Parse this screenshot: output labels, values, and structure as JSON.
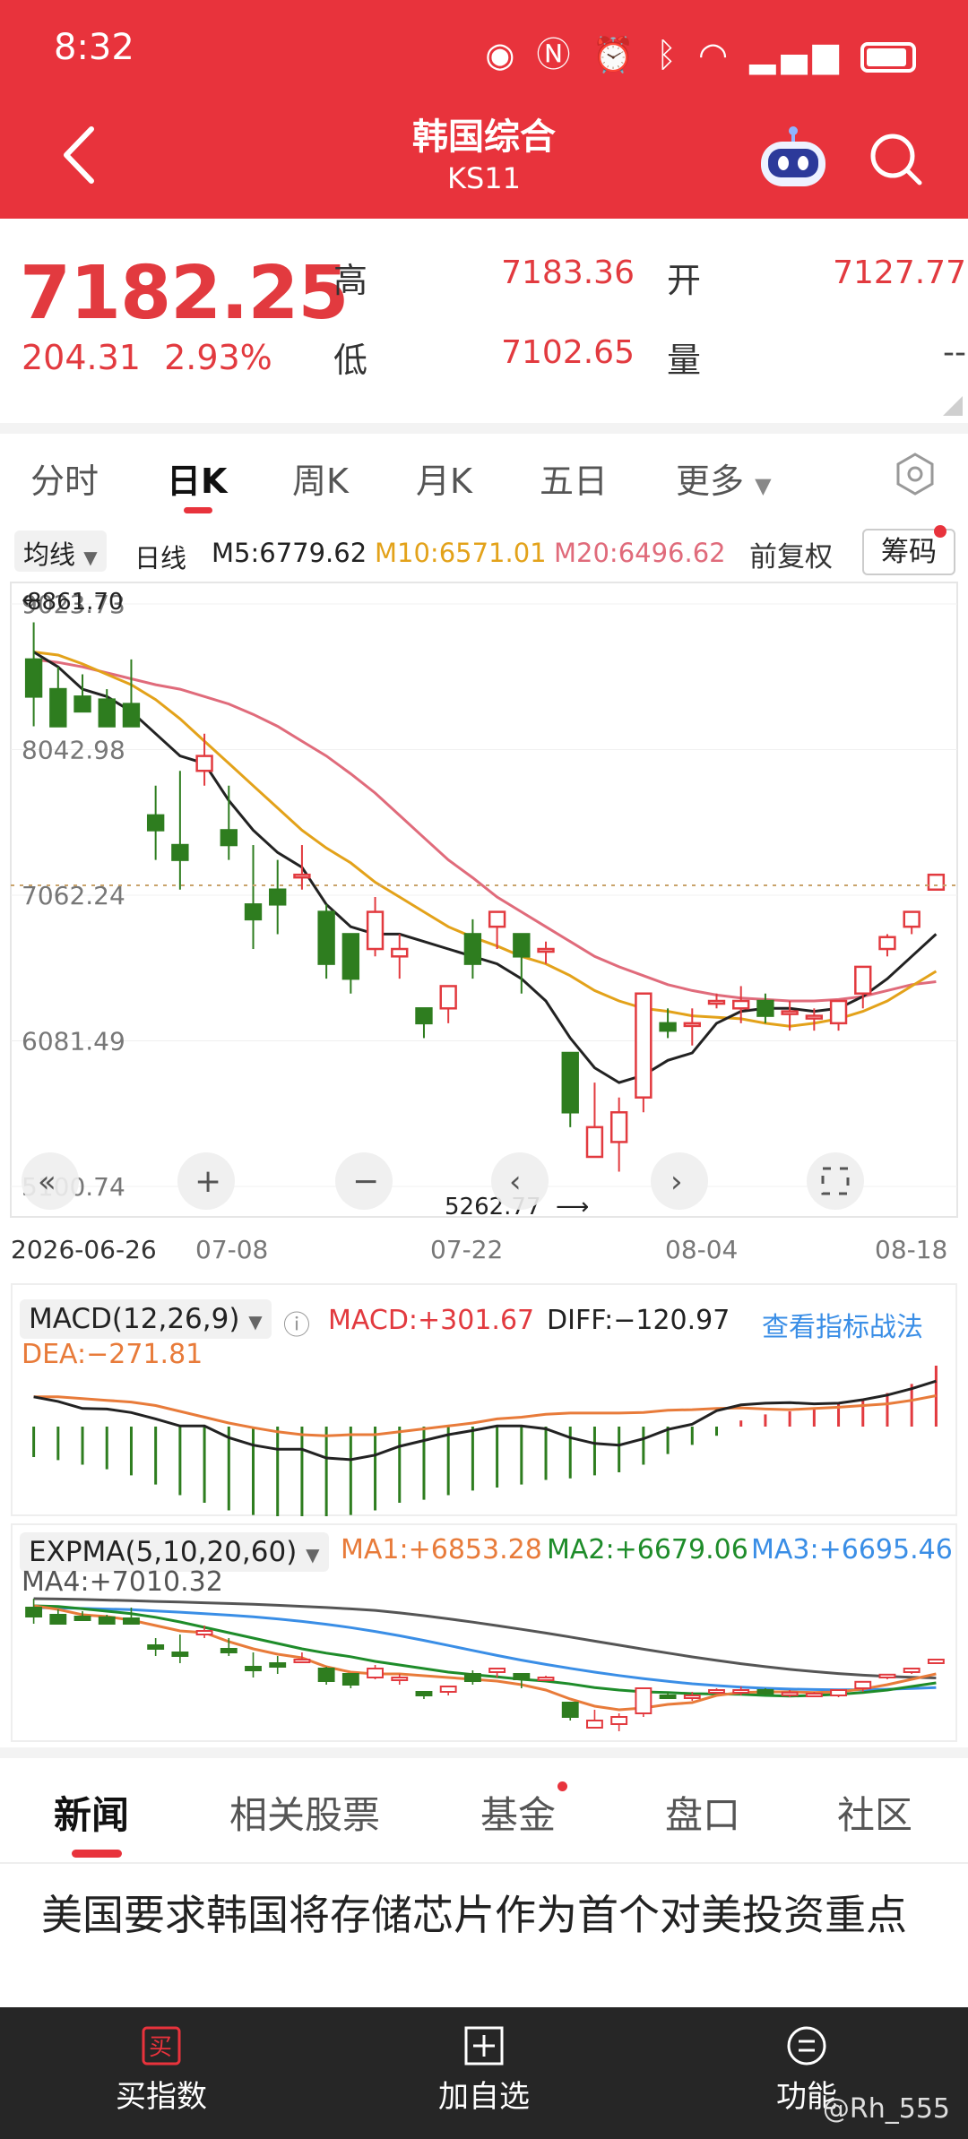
{
  "status": {
    "time": "8:32"
  },
  "header": {
    "title": "韩国综合",
    "subtitle": "KS11"
  },
  "quote": {
    "price": "7182.25",
    "change": "204.31",
    "change_pct": "2.93%",
    "high_label": "高",
    "high": "7183.36",
    "open_label": "开",
    "open": "7127.77",
    "low_label": "低",
    "low": "7102.65",
    "vol_label": "量",
    "vol": "--"
  },
  "tabs": {
    "t1": "分时",
    "t2": "日K",
    "t3": "周K",
    "t4": "月K",
    "t5": "五日",
    "t6": "更多"
  },
  "ma": {
    "select": "均线",
    "type": "日线",
    "m5": "M5:6779.62",
    "m10": "M10:6571.01",
    "m20": "M20:6496.62",
    "adj": "前复权",
    "chip": "筹码"
  },
  "chart_data": {
    "type": "candlestick",
    "y_axis_labels": [
      "9023.73",
      "8042.98",
      "7062.24",
      "6081.49",
      "5100.74"
    ],
    "ylim": [
      5100.74,
      9023.73
    ],
    "max_label": "8861.70",
    "min_label": "5262.77",
    "x_labels": [
      "2026-06-26",
      "07-08",
      "07-22",
      "08-04",
      "08-18"
    ],
    "ohlc": [
      [
        8650,
        8900,
        8400,
        8200
      ],
      [
        8450,
        8600,
        8200,
        8300
      ],
      [
        8400,
        8550,
        8300,
        8350
      ],
      [
        8380,
        8450,
        8200,
        8400
      ],
      [
        8350,
        8650,
        8200,
        8250
      ],
      [
        7600,
        7800,
        7500,
        7300
      ],
      [
        7400,
        7900,
        7300,
        7100
      ],
      [
        7900,
        8150,
        8000,
        7800
      ],
      [
        7500,
        7800,
        7400,
        7300
      ],
      [
        7000,
        7400,
        6900,
        6700
      ],
      [
        7100,
        7300,
        7000,
        6800
      ],
      [
        7200,
        7400,
        7200,
        7100
      ],
      [
        6950,
        7000,
        6600,
        6500
      ],
      [
        6800,
        6700,
        6500,
        6400
      ],
      [
        6700,
        7050,
        6950,
        6650
      ],
      [
        6650,
        6800,
        6700,
        6500
      ],
      [
        6300,
        6300,
        6200,
        6100
      ],
      [
        6300,
        6450,
        6450,
        6200
      ],
      [
        6800,
        6900,
        6600,
        6500
      ],
      [
        6850,
        6950,
        6950,
        6700
      ],
      [
        6800,
        6800,
        6650,
        6400
      ],
      [
        6700,
        6750,
        6700,
        6600
      ],
      [
        6000,
        6000,
        5600,
        5500
      ],
      [
        5300,
        5800,
        5500,
        5300
      ],
      [
        5400,
        5700,
        5600,
        5200
      ],
      [
        5700,
        6400,
        6400,
        5600
      ],
      [
        6200,
        6300,
        6150,
        6100
      ],
      [
        6200,
        6300,
        6200,
        6050
      ],
      [
        6350,
        6400,
        6350,
        6300
      ],
      [
        6300,
        6450,
        6350,
        6200
      ],
      [
        6350,
        6400,
        6250,
        6200
      ],
      [
        6280,
        6350,
        6280,
        6150
      ],
      [
        6250,
        6300,
        6250,
        6150
      ],
      [
        6200,
        6300,
        6350,
        6150
      ],
      [
        6400,
        6550,
        6580,
        6300
      ],
      [
        6700,
        6800,
        6780,
        6650
      ],
      [
        6850,
        6950,
        6950,
        6800
      ],
      [
        7100,
        7160,
        7200,
        7100
      ]
    ],
    "ma5": [
      8700,
      8600,
      8450,
      8400,
      8300,
      8150,
      8000,
      7950,
      7700,
      7500,
      7350,
      7250,
      7000,
      6850,
      6800,
      6800,
      6750,
      6700,
      6650,
      6600,
      6500,
      6350,
      6100,
      5900,
      5800,
      5850,
      5950,
      6000,
      6200,
      6280,
      6300,
      6300,
      6280,
      6300,
      6380,
      6500,
      6650,
      6800
    ],
    "ma10": [
      8700,
      8680,
      8620,
      8550,
      8480,
      8380,
      8250,
      8100,
      7950,
      7800,
      7650,
      7500,
      7380,
      7280,
      7150,
      7050,
      6950,
      6850,
      6780,
      6720,
      6650,
      6600,
      6520,
      6420,
      6350,
      6300,
      6280,
      6250,
      6240,
      6230,
      6200,
      6180,
      6200,
      6230,
      6280,
      6350,
      6450,
      6550
    ],
    "ma20": [
      8650,
      8630,
      8600,
      8560,
      8520,
      8480,
      8450,
      8400,
      8350,
      8280,
      8200,
      8100,
      8000,
      7880,
      7750,
      7600,
      7450,
      7300,
      7180,
      7050,
      6950,
      6850,
      6750,
      6650,
      6580,
      6520,
      6460,
      6420,
      6390,
      6370,
      6360,
      6350,
      6350,
      6360,
      6380,
      6420,
      6460,
      6480
    ]
  },
  "macd": {
    "name": "MACD(12,26,9)",
    "macd": "MACD:+301.67",
    "diff": "DIFF:−120.97",
    "link": "查看指标战法",
    "dea": "DEA:−271.81",
    "bars": [
      -20,
      -22,
      -25,
      -28,
      -32,
      -38,
      -45,
      -50,
      -55,
      -58,
      -60,
      -62,
      -60,
      -58,
      -55,
      -50,
      -48,
      -45,
      -42,
      -40,
      -38,
      -35,
      -34,
      -32,
      -30,
      -25,
      -18,
      -12,
      -6,
      4,
      8,
      10,
      12,
      15,
      18,
      22,
      28,
      40
    ]
  },
  "expma": {
    "name": "EXPMA(5,10,20,60)",
    "ma1": "MA1:+6853.28",
    "ma2": "MA2:+6679.06",
    "ma3": "MA3:+6695.46",
    "ma4": "MA4:+7010.32"
  },
  "news": {
    "tabs": [
      "新闻",
      "相关股票",
      "基金",
      "盘口",
      "社区"
    ],
    "headline": "美国要求韩国将存储芯片作为首个对美投资重点"
  },
  "bottom": {
    "b1": "买指数",
    "b2": "加自选",
    "b3": "功能",
    "watermark": "@Rh_555"
  },
  "colors": {
    "header_red": "#e8333c",
    "rise": "#e23a3f",
    "fall": "#2e7d1f",
    "ma5": "#222222",
    "ma10": "#e3a21a",
    "ma20": "#e06b7b"
  }
}
